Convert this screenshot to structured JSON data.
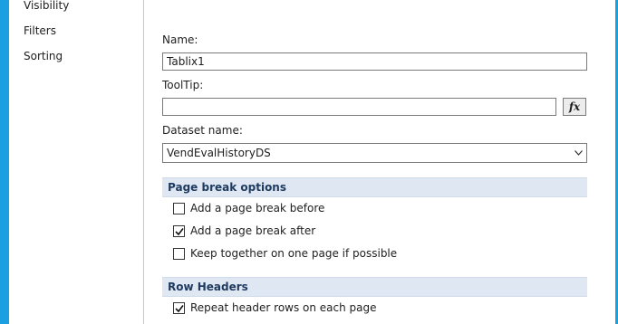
{
  "sidebar": {
    "items": [
      {
        "label": "Visibility"
      },
      {
        "label": "Filters"
      },
      {
        "label": "Sorting"
      }
    ]
  },
  "form": {
    "name_label": "Name:",
    "name_value": "Tablix1",
    "tooltip_label": "ToolTip:",
    "tooltip_value": "",
    "fx_label": "fx",
    "dataset_label": "Dataset name:",
    "dataset_value": "VendEvalHistoryDS"
  },
  "page_break": {
    "header": "Page break options",
    "options": [
      {
        "label": "Add a page break before",
        "checked": false
      },
      {
        "label": "Add a page break after",
        "checked": true
      },
      {
        "label": "Keep together on one page if possible",
        "checked": false
      }
    ]
  },
  "row_headers": {
    "header": "Row Headers",
    "options": [
      {
        "label": "Repeat header rows on each page",
        "checked": true
      }
    ]
  },
  "colors": {
    "accent": "#1a9fe0",
    "section_bg": "#dfe8f2"
  }
}
